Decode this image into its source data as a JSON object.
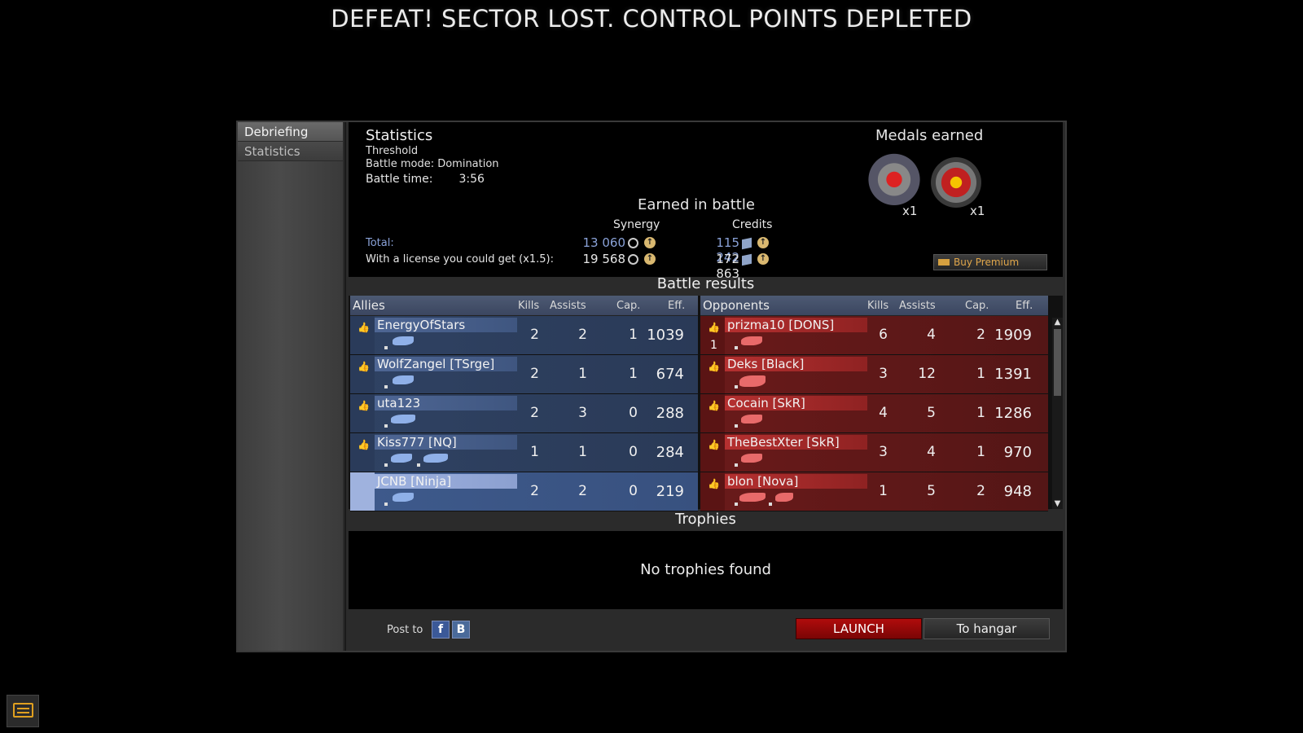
{
  "headline": "DEFEAT! SECTOR LOST. CONTROL POINTS DEPLETED",
  "sidebar": {
    "items": [
      {
        "label": "Debriefing"
      },
      {
        "label": "Statistics"
      }
    ]
  },
  "stats": {
    "title": "Statistics",
    "map": "Threshold",
    "mode": "Battle mode: Domination",
    "time_label": "Battle time:",
    "time_value": "3:56"
  },
  "earned": {
    "title": "Earned in battle",
    "col_synergy": "Synergy",
    "col_credits": "Credits",
    "total_label": "Total:",
    "total_synergy": "13 060",
    "total_credits": "115 242",
    "license_label": "With a license you could get (x1.5):",
    "license_synergy": "19 568",
    "license_credits": "172 863"
  },
  "medals": {
    "title": "Medals earned",
    "items": [
      {
        "icon": "missile-medal-icon",
        "count": "x1"
      },
      {
        "icon": "skull-medal-icon",
        "count": "x1"
      }
    ]
  },
  "buy_premium": "Buy Premium",
  "battle_results": {
    "title": "Battle results",
    "columns": {
      "kills": "Kills",
      "assists": "Assists",
      "cap": "Cap.",
      "eff": "Eff."
    },
    "allies": {
      "label": "Allies",
      "rows": [
        {
          "name": "EnergyOfStars",
          "kills": "2",
          "assists": "2",
          "cap": "1",
          "eff": "1039"
        },
        {
          "name": "WolfZangel [TSrge]",
          "kills": "2",
          "assists": "1",
          "cap": "1",
          "eff": "674"
        },
        {
          "name": "uta123",
          "kills": "2",
          "assists": "3",
          "cap": "0",
          "eff": "288"
        },
        {
          "name": "Kiss777 [NQ]",
          "kills": "1",
          "assists": "1",
          "cap": "0",
          "eff": "284"
        },
        {
          "name": "JCNB [Ninja]",
          "kills": "2",
          "assists": "2",
          "cap": "0",
          "eff": "219"
        }
      ]
    },
    "opponents": {
      "label": "Opponents",
      "rows": [
        {
          "name": "prizma10 [DONS]",
          "rank": "1",
          "kills": "6",
          "assists": "4",
          "cap": "2",
          "eff": "1909"
        },
        {
          "name": "Deks [Black]",
          "kills": "3",
          "assists": "12",
          "cap": "1",
          "eff": "1391"
        },
        {
          "name": "Cocain [SkR]",
          "kills": "4",
          "assists": "5",
          "cap": "1",
          "eff": "1286"
        },
        {
          "name": "TheBestXter [SkR]",
          "kills": "3",
          "assists": "4",
          "cap": "1",
          "eff": "970"
        },
        {
          "name": "blon [Nova]",
          "kills": "1",
          "assists": "5",
          "cap": "2",
          "eff": "948"
        }
      ]
    }
  },
  "trophies": {
    "title": "Trophies",
    "empty": "No trophies found"
  },
  "footer": {
    "post_to": "Post to",
    "facebook": "f",
    "vk": "B",
    "launch": "LAUNCH",
    "hangar": "To hangar"
  },
  "colors": {
    "ally": "#3f5680",
    "opponent": "#8f2222",
    "launch": "#b00c0c",
    "premium_text": "#e0a64a"
  }
}
